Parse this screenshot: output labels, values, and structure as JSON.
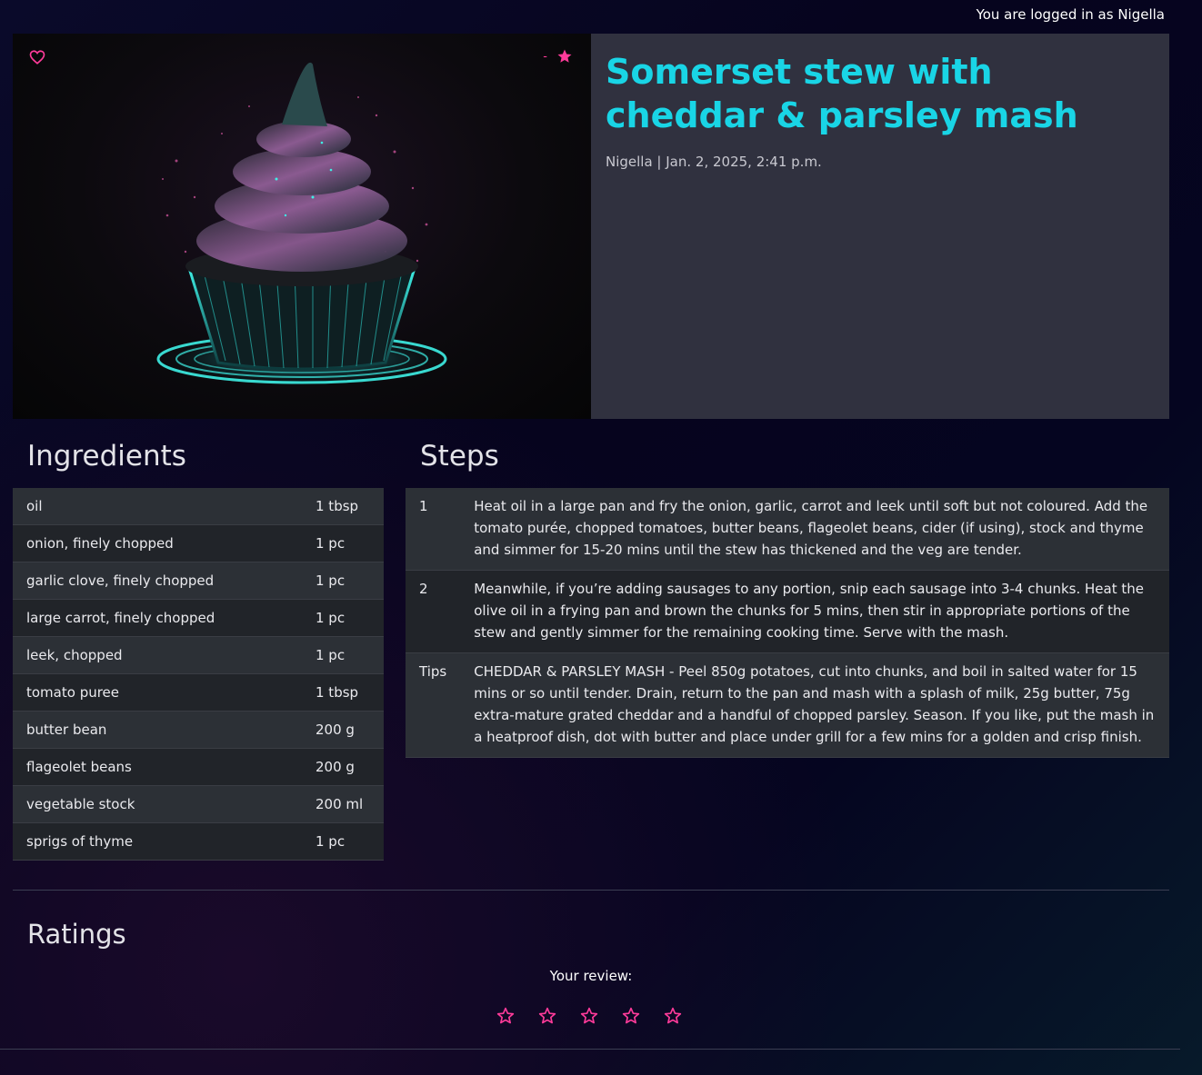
{
  "header": {
    "login_status": "You are logged in as Nigella"
  },
  "recipe": {
    "title": "Somerset stew with cheddar & parsley mash",
    "meta": "Nigella | Jan. 2, 2025, 2:41 p.m.",
    "star_badge_text": "-",
    "accent_color": "#19d5e6",
    "pink_color": "#ff3b9a"
  },
  "sections": {
    "ingredients": "Ingredients",
    "steps": "Steps",
    "ratings": "Ratings"
  },
  "ingredients": [
    {
      "name": "oil",
      "qty": "1 tbsp"
    },
    {
      "name": "onion, finely chopped",
      "qty": "1 pc"
    },
    {
      "name": "garlic clove, finely chopped",
      "qty": "1 pc"
    },
    {
      "name": "large carrot, finely chopped",
      "qty": "1 pc"
    },
    {
      "name": "leek, chopped",
      "qty": "1 pc"
    },
    {
      "name": "tomato puree",
      "qty": "1 tbsp"
    },
    {
      "name": "butter bean",
      "qty": "200 g"
    },
    {
      "name": "flageolet beans",
      "qty": "200 g"
    },
    {
      "name": "vegetable stock",
      "qty": "200 ml"
    },
    {
      "name": "sprigs of thyme",
      "qty": "1 pc"
    }
  ],
  "steps": [
    {
      "num": "1",
      "text": "Heat oil in a large pan and fry the onion, garlic, carrot and leek until soft but not coloured. Add the tomato purée, chopped tomatoes, butter beans, flageolet beans, cider (if using), stock and thyme and simmer for 15-20 mins until the stew has thickened and the veg are tender."
    },
    {
      "num": "2",
      "text": "Meanwhile, if you’re adding sausages to any portion, snip each sausage into 3-4 chunks. Heat the olive oil in a frying pan and brown the chunks for 5 mins, then stir in appropriate portions of the stew and gently simmer for the remaining cooking time. Serve with the mash."
    },
    {
      "num": "Tips",
      "text": "CHEDDAR & PARSLEY MASH - Peel 850g potatoes, cut into chunks, and boil in salted water for 15 mins or so until tender. Drain, return to the pan and mash with a splash of milk, 25g butter, 75g extra-mature grated cheddar and a handful of chopped parsley. Season. If you like, put the mash in a heatproof dish, dot with butter and place under grill for a few mins for a golden and crisp finish."
    }
  ],
  "ratings": {
    "review_label": "Your review:",
    "star_count": 5,
    "rating": 0
  },
  "icons": {
    "favorite": "heart-outline-icon",
    "star_badge": "star-filled-icon",
    "review_star": "star-outline-icon"
  }
}
